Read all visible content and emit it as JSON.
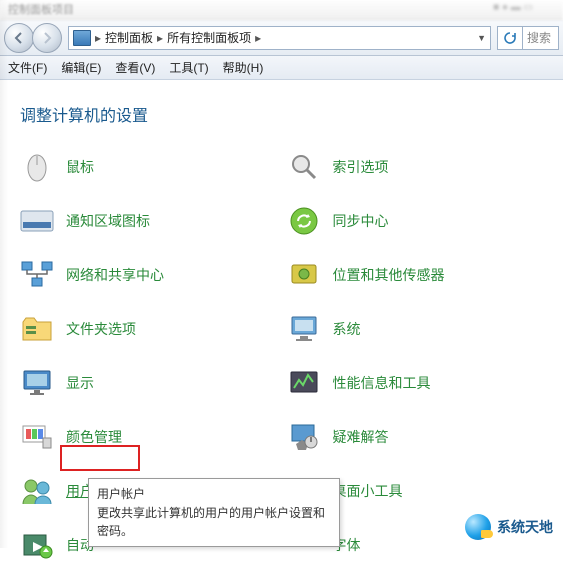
{
  "window": {
    "title_blur": "控制面板项目"
  },
  "breadcrumb": {
    "root": "控制面板",
    "sub": "所有控制面板项"
  },
  "search": {
    "placeholder": "搜索"
  },
  "menu": {
    "file": "文件(F)",
    "edit": "编辑(E)",
    "view": "查看(V)",
    "tools": "工具(T)",
    "help": "帮助(H)"
  },
  "heading": "调整计算机的设置",
  "items": {
    "mouse": "鼠标",
    "indexing": "索引选项",
    "notification": "通知区域图标",
    "sync": "同步中心",
    "network": "网络和共享中心",
    "sensors": "位置和其他传感器",
    "folder": "文件夹选项",
    "system": "系统",
    "display": "显示",
    "perf": "性能信息和工具",
    "color": "颜色管理",
    "troubleshoot": "疑难解答",
    "user": "用户帐户",
    "gadgets": "桌面小工具",
    "autoplay_prefix": "自动",
    "font": "字体"
  },
  "tooltip": {
    "title": "用户帐户",
    "body": "更改共享此计算机的用户的用户帐户设置和密码。"
  },
  "watermark": "系统天地"
}
